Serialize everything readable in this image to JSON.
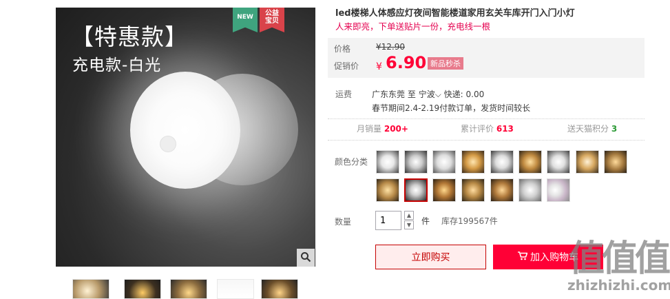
{
  "main_image": {
    "promo_title": "【特惠款】",
    "promo_subtitle": "充电款-白光",
    "badge_new": "NEW",
    "badge_public_line1": "公益",
    "badge_public_line2": "宝贝"
  },
  "thumbnails": [
    "thumb-1",
    "thumb-2",
    "thumb-3",
    "thumb-4",
    "thumb-5"
  ],
  "product": {
    "title": "led楼梯人体感应灯夜间智能楼道家用玄关车库开门入门小灯",
    "subtitle": "人来即亮，下单送贴片一份，充电线一根"
  },
  "price": {
    "label_price": "价格",
    "old_price": "¥12.90",
    "label_promo": "促销价",
    "currency": "¥",
    "new_price": "6.90",
    "sale_tag": "新品秒杀"
  },
  "shipping": {
    "label": "运费",
    "from": "广东东莞",
    "to_word": "至",
    "destination": "宁波",
    "method": "快递: 0.00",
    "note": "春节期间2.4-2.19付款订单，发货时间较长"
  },
  "stats": {
    "monthly_sales_label": "月销量",
    "monthly_sales_value": "200+",
    "reviews_label": "累计评价",
    "reviews_value": "613",
    "points_label": "送天猫积分",
    "points_value": "3"
  },
  "options": {
    "color_label": "颜色分类",
    "quantity_label": "数量",
    "quantity_value": "1",
    "unit": "件",
    "stock": "库存199567件"
  },
  "actions": {
    "buy_now": "立即购买",
    "add_to_cart": "加入购物车"
  },
  "watermark": {
    "cn": "值值值",
    "site": "zhizhizhi.com"
  },
  "colors": {
    "accent": "#ff0036",
    "deep_red": "#c40000"
  }
}
